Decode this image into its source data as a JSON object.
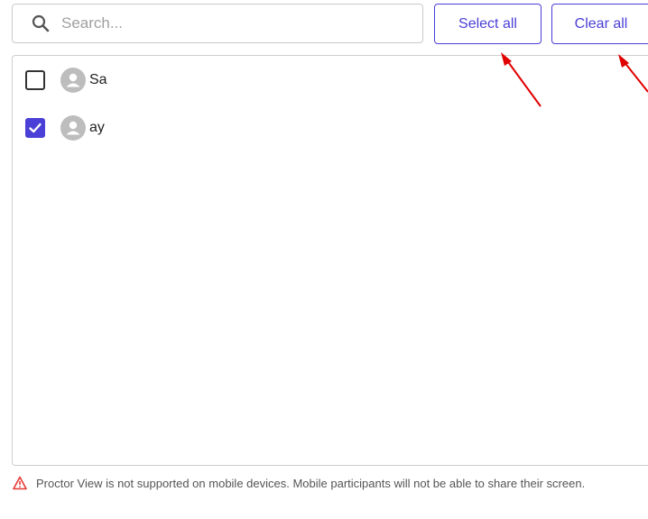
{
  "search": {
    "placeholder": "Search..."
  },
  "toolbar": {
    "select_all_label": "Select all",
    "clear_all_label": "Clear all"
  },
  "participants": [
    {
      "name": "Sa",
      "checked": false,
      "avatar": "person-icon"
    },
    {
      "name": "ay",
      "checked": true,
      "avatar": "person-icon"
    }
  ],
  "warning": {
    "icon": "warning-triangle-icon",
    "text": "Proctor View is not supported on mobile devices. Mobile participants will not be able to share their screen."
  },
  "colors": {
    "accent": "#4a3fd6",
    "warning": "#e53935",
    "annotation_arrow": "#e00000"
  }
}
